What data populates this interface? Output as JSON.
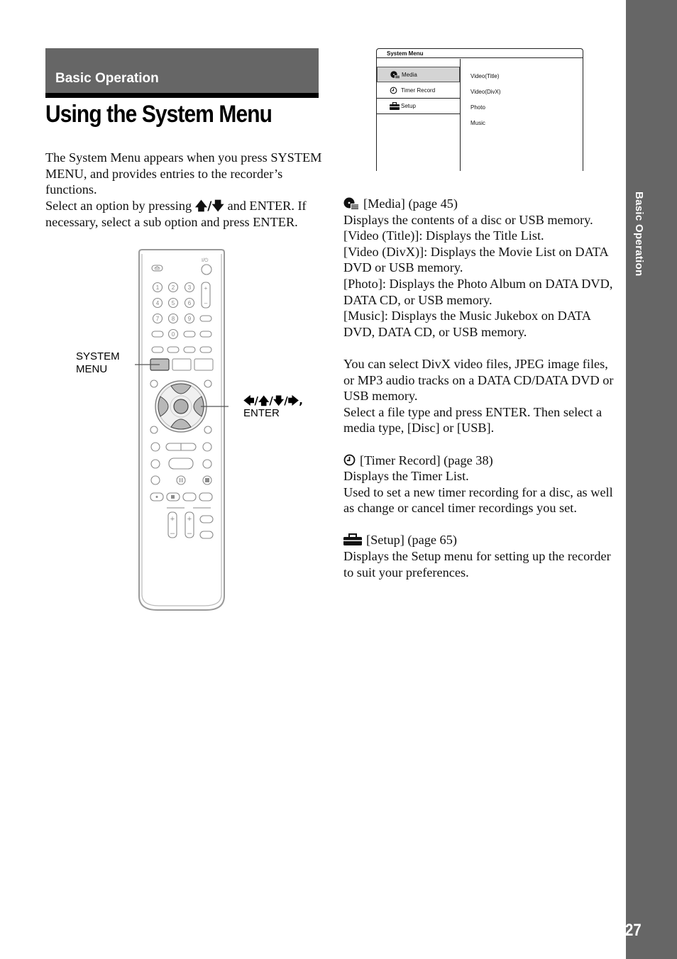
{
  "header": {
    "section_label": "Basic Operation",
    "page_title": "Using the System Menu"
  },
  "intro": {
    "p1": "The System Menu appears when you press SYSTEM MENU, and provides entries to the recorder’s functions.",
    "p2_before": "Select an option by pressing ",
    "p2_arrows": "🡅/🡇",
    "p2_after": " and ENTER. If necessary, select a sub option and press ENTER."
  },
  "system_menu_screen": {
    "title": "System Menu",
    "left_items": [
      {
        "label": "Media",
        "icon": "media-disc-icon",
        "selected": true
      },
      {
        "label": "Timer Record",
        "icon": "clock-icon",
        "selected": false
      },
      {
        "label": "Setup",
        "icon": "toolbox-icon",
        "selected": false
      }
    ],
    "right_items": [
      "Video(Title)",
      "Video(DivX)",
      "Photo",
      "Music"
    ]
  },
  "remote": {
    "callout_system_menu": "SYSTEM\nMENU",
    "callout_system_line1": "SYSTEM",
    "callout_system_line2": "MENU",
    "callout_enter_arrows": "🡄/🡅/🡇/🡆,",
    "callout_enter_label": "ENTER",
    "number_keys": [
      "1",
      "2",
      "3",
      "4",
      "5",
      "6",
      "7",
      "8",
      "9",
      "0"
    ]
  },
  "sections": {
    "media": {
      "heading": "[Media] (page 45)",
      "lines": [
        "Displays the contents of a disc or USB memory.",
        "[Video (Title)]: Displays the Title List.",
        "[Video (DivX)]: Displays the Movie List on DATA DVD or USB memory.",
        "[Photo]: Displays the Photo Album on DATA DVD, DATA CD, or USB memory.",
        "[Music]: Displays the Music Jukebox on DATA DVD, DATA CD, or USB memory."
      ],
      "note1": "You can select DivX video files, JPEG image files, or MP3 audio tracks on a DATA CD/DATA DVD or USB memory.",
      "note2": "Select a file type and press ENTER. Then select a media type, [Disc] or [USB]."
    },
    "timer": {
      "heading": "[Timer Record] (page 38)",
      "lines": [
        "Displays the Timer List.",
        "Used to set a new timer recording for a disc, as well as change or cancel timer recordings you set."
      ]
    },
    "setup": {
      "heading": "[Setup] (page 65)",
      "lines": [
        "Displays the Setup menu for setting up the recorder to suit your preferences."
      ]
    }
  },
  "side_tab": {
    "label": "Basic Operation",
    "page_number": "27"
  }
}
